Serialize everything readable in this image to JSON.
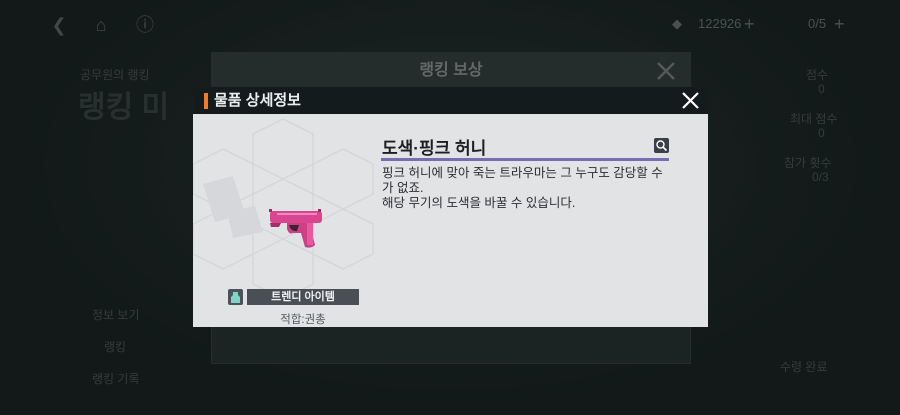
{
  "topbar": {
    "currency_1": "122926",
    "currency_2": "0/5"
  },
  "background": {
    "subtitle": "공무원의 랭킹",
    "heading": "랭킹 미",
    "side_label_1": "점수",
    "side_value_1": "0",
    "side_label_2": "최대 점수",
    "side_value_2": "0",
    "side_label_3": "참가 횟수",
    "side_value_3": "0/3",
    "menu_1": "정보 보기",
    "menu_2": "랭킹",
    "menu_3": "랭킹 기록",
    "bottom_btn": "수령 완료"
  },
  "back_panel": {
    "title": "랭킹 보상"
  },
  "modal": {
    "title": "물품 상세정보",
    "item_name": "도색·핑크 허니",
    "description": "핑크 허니에 맞아 죽는 트라우마는 그 누구도 감당할 수가 없죠.\n해당 무기의 도색을 바꿀 수 있습니다.",
    "tag": "트렌디 아이템",
    "suitability": "적합:권총",
    "accent_color": "#f07b2a",
    "name_line_color": "#7a6bb5"
  },
  "icons": [
    "back-arrow-icon",
    "home-icon",
    "info-icon",
    "currency-icon",
    "plus-icon",
    "close-icon",
    "zoom-icon",
    "trendy-tag-icon"
  ]
}
